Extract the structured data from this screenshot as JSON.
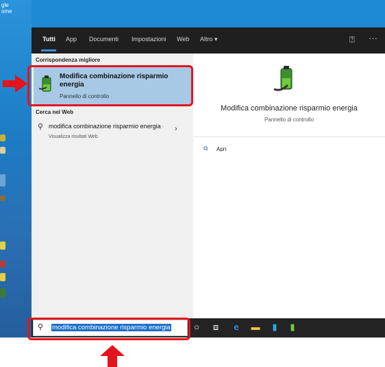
{
  "desktop": {
    "label_top": "gle\nome"
  },
  "tabs": [
    {
      "label": "Tutti",
      "active": true
    },
    {
      "label": "App",
      "active": false
    },
    {
      "label": "Documenti",
      "active": false
    },
    {
      "label": "Impostazioni",
      "active": false
    },
    {
      "label": "Web",
      "active": false
    },
    {
      "label": "Altro ▾",
      "active": false
    }
  ],
  "tabbar_icons": {
    "feedback": "feedback-icon",
    "more": "ellipsis-icon"
  },
  "results": {
    "best_match_header": "Corrispondenza migliore",
    "best_match": {
      "title": "Modifica combinazione risparmio energia",
      "subtitle": "Pannello di controllo",
      "icon": "battery-icon"
    },
    "web_header": "Cerca nel Web",
    "web_result": {
      "query_bold": "modifica combinazione risparmio energia",
      "suffix": " - Visualizza risultati Web"
    }
  },
  "detail": {
    "title": "Modifica combinazione risparmio energia",
    "subtitle": "Pannello di controllo",
    "actions": [
      {
        "label": "Apri",
        "icon": "open-icon"
      }
    ]
  },
  "taskbar": {
    "search_value": "modifica combinazione risparmio energia",
    "icons": [
      "cortana-icon",
      "task-view-icon",
      "edge-icon",
      "file-explorer-icon",
      "store-icon",
      "power-options-icon"
    ]
  },
  "colors": {
    "accent": "#3b8cdb",
    "highlight": "#a7c9e6",
    "annotation_red": "#e3141b",
    "tabbar": "#1f1f1f"
  }
}
